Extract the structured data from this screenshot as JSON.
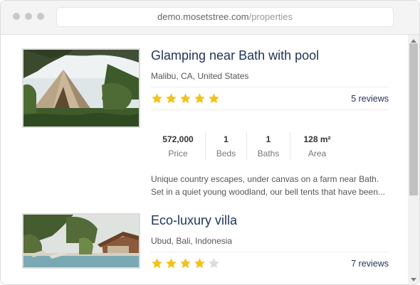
{
  "browser": {
    "domain": "demo.mosetstree.com",
    "path": "/properties"
  },
  "listings": [
    {
      "title": "Glamping near Bath with pool",
      "location": "Malibu, CA, United States",
      "rating": 5,
      "max_rating": 5,
      "reviews": "5 reviews",
      "stats": [
        {
          "value": "572,000",
          "label": "Price"
        },
        {
          "value": "1",
          "label": "Beds"
        },
        {
          "value": "1",
          "label": "Baths"
        },
        {
          "value": "128 m²",
          "label": "Area"
        }
      ],
      "description_lines": [
        "Unique country escapes, under canvas on a farm near Bath.",
        "Set in a quiet young woodland, our bell tents that have been..."
      ]
    },
    {
      "title": "Eco-luxury villa",
      "location": "Ubud, Bali, Indonesia",
      "rating": 4,
      "max_rating": 5,
      "reviews": "7 reviews"
    }
  ],
  "colors": {
    "star_filled": "#f5c21b",
    "star_empty": "#dcdcdc",
    "title": "#1f3358"
  }
}
